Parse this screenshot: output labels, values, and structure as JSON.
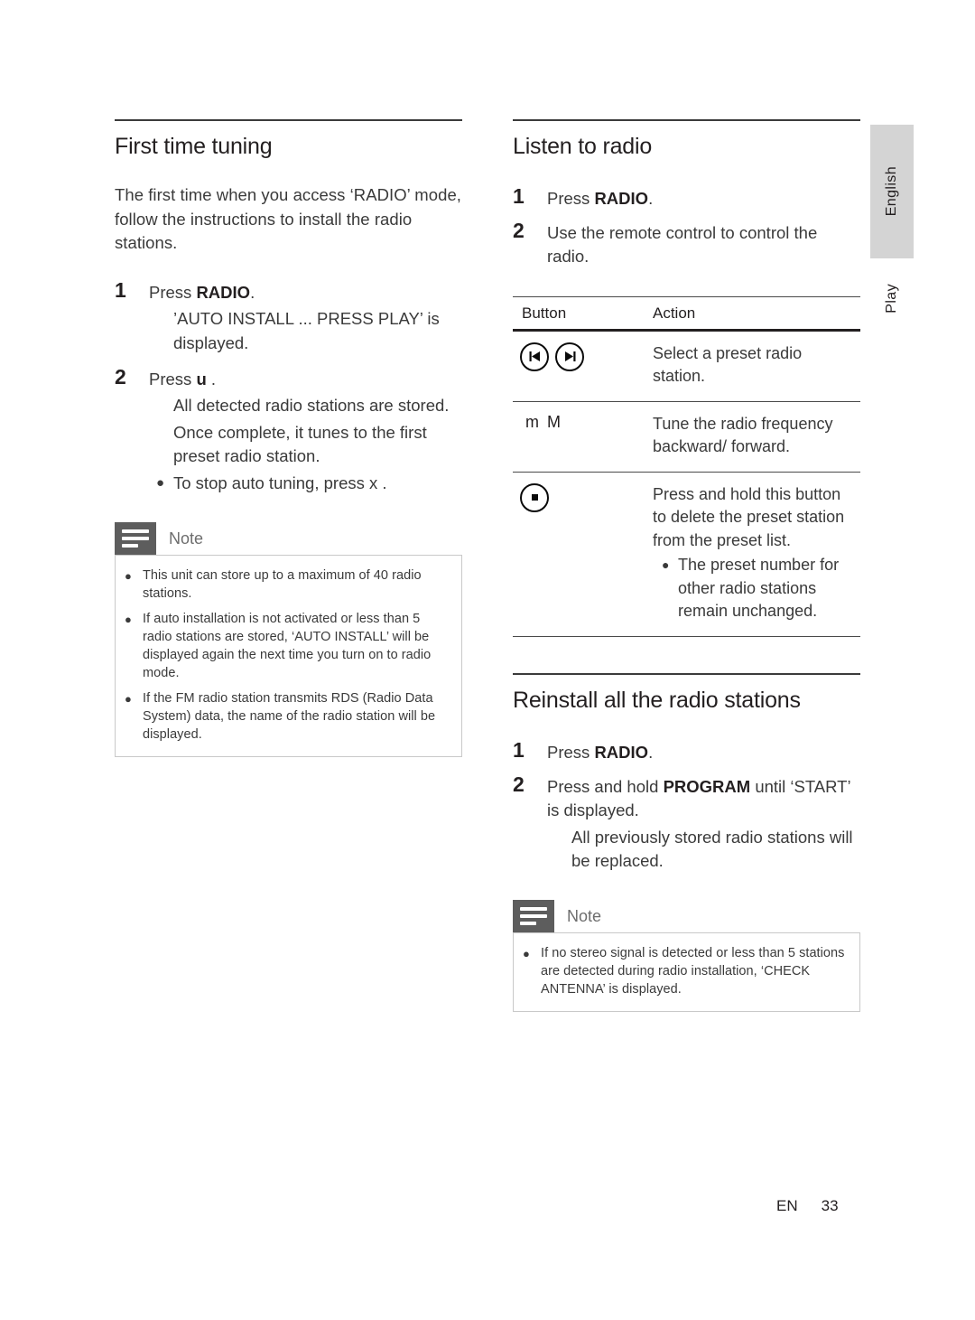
{
  "page": {
    "footer_lang": "EN",
    "footer_number": "33",
    "side_tab_language": "English",
    "side_tab_chapter": "Play"
  },
  "left_column": {
    "section": {
      "title": "First time tuning",
      "intro": "The first time when you access ‘RADIO’ mode, follow the instructions to install the radio stations.",
      "steps": [
        {
          "num": "1",
          "text_pre": "Press ",
          "text_bold": "RADIO",
          "text_post": ".",
          "sub_lines": [
            "’AUTO INSTALL ... PRESS PLAY’ is displayed."
          ],
          "bullets": []
        },
        {
          "num": "2",
          "text_pre": "Press ",
          "text_bold": "u",
          "text_post": "  .",
          "sub_lines": [
            "All detected radio stations are stored.",
            "Once complete, it tunes to the first preset radio station."
          ],
          "bullets": [
            "To stop auto tuning, press x ."
          ]
        }
      ]
    },
    "note": {
      "title": "Note",
      "items": [
        "This unit can store up to a maximum of 40 radio stations.",
        "If auto installation is not activated or less than 5 radio stations are stored, ‘AUTO INSTALL’ will be displayed again the next time you turn on to radio mode.",
        "If the FM radio station transmits RDS (Radio Data System) data, the name of the radio station will be displayed."
      ]
    }
  },
  "right_column": {
    "listen_section": {
      "title": "Listen to radio",
      "steps": [
        {
          "num": "1",
          "text_pre": "Press ",
          "text_bold": "RADIO",
          "text_post": "."
        },
        {
          "num": "2",
          "text_pre": "Use the remote control to control the radio.",
          "text_bold": "",
          "text_post": ""
        }
      ]
    },
    "table": {
      "headers": {
        "button": "Button",
        "action": "Action"
      },
      "rows": [
        {
          "icons": [
            "previous-track-icon",
            "next-track-icon"
          ],
          "key_label": "",
          "action": "Select a preset radio station.",
          "action_bullets": []
        },
        {
          "icons": [],
          "key_label": "m  M",
          "action": "Tune the radio frequency backward/ forward.",
          "action_bullets": []
        },
        {
          "icons": [
            "stop-icon"
          ],
          "key_label": "",
          "action": "Press and hold this button to delete the preset station from the preset list.",
          "action_bullets": [
            "The preset number for other radio stations remain unchanged."
          ]
        }
      ]
    },
    "reinstall_section": {
      "title": "Reinstall all the radio stations",
      "steps": [
        {
          "num": "1",
          "text_pre": "Press ",
          "text_bold": "RADIO",
          "text_post": ".",
          "sub_lines": []
        },
        {
          "num": "2",
          "text_pre": "Press and hold ",
          "text_bold": "PROGRAM",
          "text_post": " until ‘START’ is displayed.",
          "sub_lines": [
            "All previously stored radio stations will be replaced."
          ]
        }
      ]
    },
    "note": {
      "title": "Note",
      "items": [
        "If no stereo signal is detected or less than 5 stations are detected during radio installation, ‘CHECK ANTENNA’ is displayed."
      ]
    }
  }
}
